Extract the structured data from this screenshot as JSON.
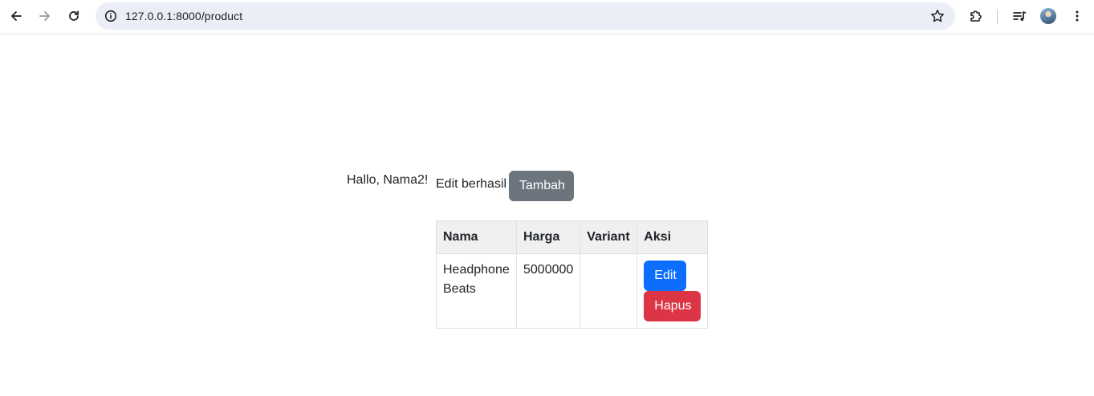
{
  "browser": {
    "url": "127.0.0.1:8000/product",
    "icons": {
      "back": "arrow-left-icon",
      "forward": "arrow-right-icon",
      "reload": "reload-icon",
      "site_info": "info-icon",
      "bookmark": "star-icon",
      "extensions": "puzzle-icon",
      "media": "media-queue-icon",
      "profile": "avatar",
      "menu": "kebab-menu-icon"
    }
  },
  "page": {
    "greeting": "Hallo, Nama2!",
    "flash_message": "Edit berhasil",
    "add_button": "Tambah",
    "table": {
      "headers": [
        "Nama",
        "Harga",
        "Variant",
        "Aksi"
      ],
      "rows": [
        {
          "nama": "Headphone Beats",
          "harga": "5000000",
          "variant": "",
          "actions": {
            "edit": "Edit",
            "delete": "Hapus"
          }
        }
      ]
    }
  },
  "colors": {
    "secondary": "#6c757d",
    "primary": "#0d6efd",
    "danger": "#dc3545",
    "omnibox_bg": "#ebeef6"
  }
}
